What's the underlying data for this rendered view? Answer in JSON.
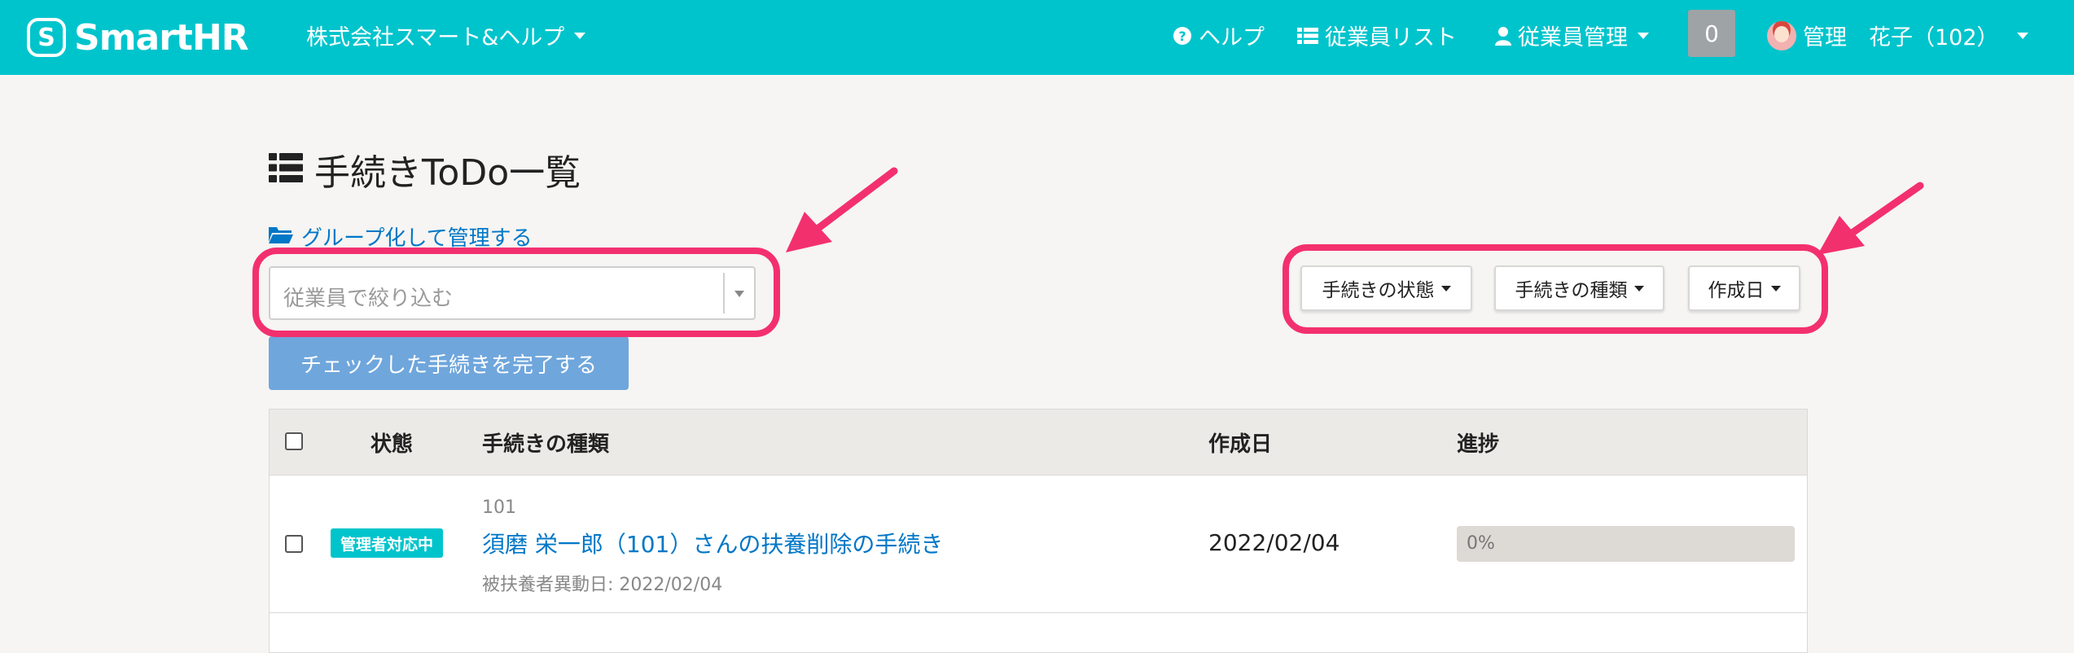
{
  "header": {
    "logo_text": "SmartHR",
    "company": "株式会社スマート&ヘルプ",
    "help_label": "ヘルプ",
    "employee_list_label": "従業員リスト",
    "employee_mgmt_label": "従業員管理",
    "notification_count": "0",
    "user_name": "管理　花子（102）",
    "brand_color": "#00c4cc"
  },
  "page": {
    "title": "手続きToDo一覧",
    "group_link": "グループ化して管理する",
    "employee_filter_placeholder": "従業員で絞り込む",
    "complete_button": "チェックした手続きを完了する",
    "filters": {
      "status": "手続きの状態",
      "type": "手続きの種類",
      "created": "作成日"
    },
    "highlight_color": "#f3306e"
  },
  "table": {
    "headers": {
      "status": "状態",
      "type": "手続きの種類",
      "created": "作成日",
      "progress": "進捗"
    },
    "rows": [
      {
        "status": "管理者対応中",
        "employee_number": "101",
        "procedure": "須磨 栄一郎（101）さんの扶養削除の手続き",
        "sub": "被扶養者異動日: 2022/02/04",
        "created": "2022/02/04",
        "progress_label": "0%",
        "progress_value": 0
      }
    ]
  }
}
